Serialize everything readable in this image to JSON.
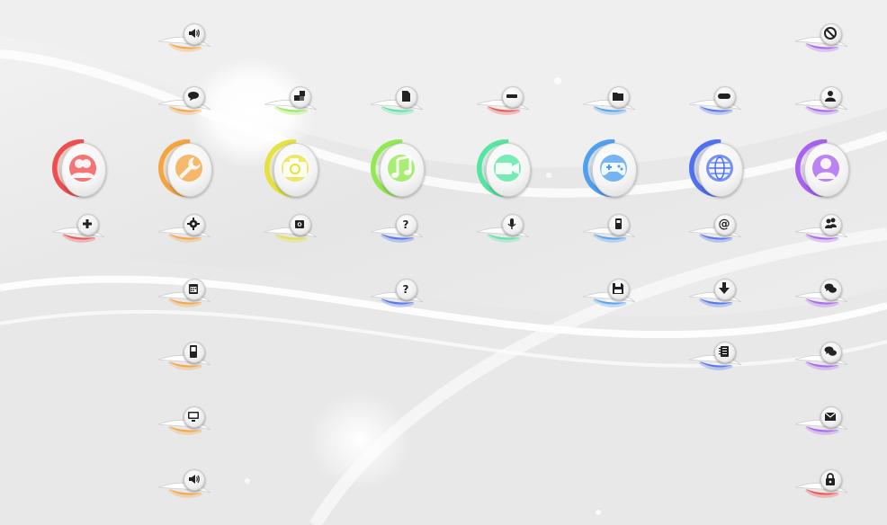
{
  "colors": {
    "red": "#f04848",
    "orange": "#f4a23a",
    "yellow": "#e6e23a",
    "lime": "#8ee84a",
    "green": "#4ee6a0",
    "blue": "#4a9cf0",
    "indigo": "#4a6cf0",
    "violet": "#a45cf0",
    "glyph": "#222222"
  },
  "main_icons": [
    {
      "id": "users",
      "color": "red",
      "icon": "users-icon"
    },
    {
      "id": "settings",
      "color": "orange",
      "icon": "wrench-icon"
    },
    {
      "id": "photos",
      "color": "yellow",
      "icon": "camera-icon"
    },
    {
      "id": "music",
      "color": "lime",
      "icon": "music-note-icon"
    },
    {
      "id": "video",
      "color": "green",
      "icon": "video-camera-icon"
    },
    {
      "id": "games",
      "color": "blue",
      "icon": "gamepad-icon"
    },
    {
      "id": "internet",
      "color": "indigo",
      "icon": "globe-icon"
    },
    {
      "id": "account",
      "color": "violet",
      "icon": "user-icon"
    }
  ],
  "sub_icons": [
    {
      "col": 1,
      "color": "orange",
      "icon": "speaker-icon",
      "glyph": "speaker"
    },
    {
      "col": 7,
      "color": "violet",
      "icon": "no-entry-icon",
      "glyph": "noentry"
    },
    {
      "col": 1,
      "color": "orange",
      "icon": "chat-bubble-icon",
      "glyph": "chat"
    },
    {
      "col": 2,
      "color": "lime",
      "icon": "puzzle-icon",
      "glyph": "puzzle"
    },
    {
      "col": 3,
      "color": "green",
      "icon": "file-icon",
      "glyph": "file"
    },
    {
      "col": 4,
      "color": "red",
      "icon": "minus-bar-icon",
      "glyph": "minus"
    },
    {
      "col": 5,
      "color": "blue",
      "icon": "folder-icon",
      "glyph": "folder"
    },
    {
      "col": 6,
      "color": "indigo",
      "icon": "pill-bar-icon",
      "glyph": "pill"
    },
    {
      "col": 7,
      "color": "violet",
      "icon": "add-user-icon",
      "glyph": "adduser"
    },
    {
      "col": 0,
      "color": "red",
      "icon": "plus-icon",
      "glyph": "plus"
    },
    {
      "col": 1,
      "color": "orange",
      "icon": "gear-icon",
      "glyph": "gear"
    },
    {
      "col": 2,
      "color": "yellow",
      "icon": "small-camera-icon",
      "glyph": "camera"
    },
    {
      "col": 3,
      "color": "indigo",
      "icon": "help-icon",
      "glyph": "help"
    },
    {
      "col": 4,
      "color": "green",
      "icon": "microphone-icon",
      "glyph": "mic"
    },
    {
      "col": 5,
      "color": "blue",
      "icon": "phone-icon",
      "glyph": "phone"
    },
    {
      "col": 6,
      "color": "indigo",
      "icon": "at-sign-icon",
      "glyph": "at"
    },
    {
      "col": 7,
      "color": "violet",
      "icon": "group-users-icon",
      "glyph": "group"
    },
    {
      "col": 1,
      "color": "orange",
      "icon": "calendar-icon",
      "glyph": "calendar"
    },
    {
      "col": 3,
      "color": "indigo",
      "icon": "help-icon",
      "glyph": "help"
    },
    {
      "col": 5,
      "color": "blue",
      "icon": "floppy-disk-icon",
      "glyph": "floppy"
    },
    {
      "col": 6,
      "color": "indigo",
      "icon": "download-icon",
      "glyph": "download"
    },
    {
      "col": 7,
      "color": "violet",
      "icon": "chat-bubbles-icon",
      "glyph": "chats"
    },
    {
      "col": 1,
      "color": "orange",
      "icon": "mobile-icon",
      "glyph": "mobile"
    },
    {
      "col": 6,
      "color": "indigo",
      "icon": "notebook-icon",
      "glyph": "notebook"
    },
    {
      "col": 7,
      "color": "violet",
      "icon": "chat-bubbles-icon",
      "glyph": "chats"
    },
    {
      "col": 1,
      "color": "orange",
      "icon": "monitor-icon",
      "glyph": "monitor"
    },
    {
      "col": 7,
      "color": "violet",
      "icon": "envelope-icon",
      "glyph": "mail"
    },
    {
      "col": 1,
      "color": "orange",
      "icon": "speaker-icon",
      "glyph": "speaker"
    },
    {
      "col": 7,
      "color": "red",
      "icon": "lock-icon",
      "glyph": "lock"
    }
  ]
}
